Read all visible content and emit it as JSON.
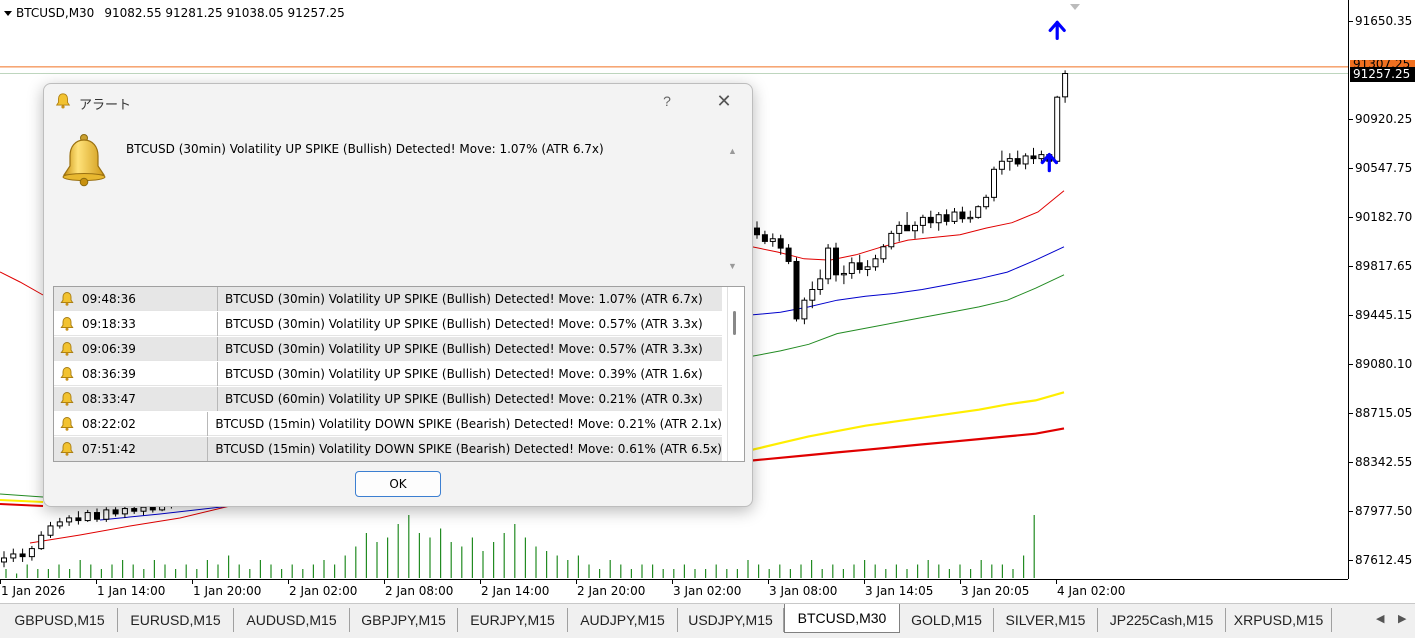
{
  "header": {
    "symbol": "BTCUSD,M30",
    "ohlc": "91082.55 91281.25 91038.05 91257.25"
  },
  "price_axis": {
    "labels": [
      "91650.35",
      "90920.25",
      "90547.75",
      "90182.70",
      "89817.65",
      "89445.15",
      "89080.10",
      "88715.05",
      "88342.55",
      "87977.50",
      "87612.45"
    ],
    "tag_orange": "91307.25",
    "tag_current": "91257.25"
  },
  "time_axis": {
    "labels": [
      "1 Jan 2026",
      "1 Jan 14:00",
      "1 Jan 20:00",
      "2 Jan 02:00",
      "2 Jan 08:00",
      "2 Jan 14:00",
      "2 Jan 20:00",
      "3 Jan 02:00",
      "3 Jan 08:00",
      "3 Jan 14:05",
      "3 Jan 20:05",
      "4 Jan 02:00"
    ]
  },
  "colors": {
    "bull": "#ffffff",
    "bear": "#000000",
    "ma_fast": "#e00000",
    "ma_mid": "#0000cc",
    "ma_slow": "#228b22",
    "ma_yellow": "#ffee00",
    "ma_red_thick": "#e00000",
    "volume": "#228b22",
    "arrow": "#0000ff",
    "price_line": "#f07020"
  },
  "chart_data": {
    "type": "candlestick",
    "symbol": "BTCUSD",
    "timeframe": "M30",
    "ylim": [
      87450,
      91800
    ],
    "last_price": 91257.25,
    "orange_level": 91307.25,
    "left_segment": [
      {
        "o": 87600,
        "h": 87680,
        "l": 87560,
        "c": 87630
      },
      {
        "o": 87630,
        "h": 87700,
        "l": 87600,
        "c": 87660
      },
      {
        "o": 87660,
        "h": 87700,
        "l": 87600,
        "c": 87640
      },
      {
        "o": 87640,
        "h": 87720,
        "l": 87610,
        "c": 87700
      },
      {
        "o": 87700,
        "h": 87830,
        "l": 87690,
        "c": 87800
      },
      {
        "o": 87800,
        "h": 87900,
        "l": 87780,
        "c": 87870
      },
      {
        "o": 87870,
        "h": 87930,
        "l": 87850,
        "c": 87900
      },
      {
        "o": 87900,
        "h": 87950,
        "l": 87870,
        "c": 87930
      },
      {
        "o": 87930,
        "h": 87980,
        "l": 87880,
        "c": 87910
      },
      {
        "o": 87910,
        "h": 87990,
        "l": 87900,
        "c": 87970
      },
      {
        "o": 87970,
        "h": 88000,
        "l": 87900,
        "c": 87920
      },
      {
        "o": 87920,
        "h": 88010,
        "l": 87900,
        "c": 87990
      },
      {
        "o": 87990,
        "h": 88010,
        "l": 87940,
        "c": 87960
      },
      {
        "o": 87960,
        "h": 88020,
        "l": 87930,
        "c": 88000
      },
      {
        "o": 88000,
        "h": 88040,
        "l": 87960,
        "c": 87980
      },
      {
        "o": 87980,
        "h": 88030,
        "l": 87950,
        "c": 88010
      },
      {
        "o": 88010,
        "h": 88050,
        "l": 87970,
        "c": 87990
      },
      {
        "o": 87990,
        "h": 88060,
        "l": 87980,
        "c": 88040
      },
      {
        "o": 88040,
        "h": 88080,
        "l": 88000,
        "c": 88020
      }
    ],
    "right_segment": [
      {
        "o": 90100,
        "h": 90150,
        "l": 90020,
        "c": 90050
      },
      {
        "o": 90050,
        "h": 90080,
        "l": 89980,
        "c": 90000
      },
      {
        "o": 90000,
        "h": 90060,
        "l": 89960,
        "c": 90020
      },
      {
        "o": 90020,
        "h": 90050,
        "l": 89900,
        "c": 89950
      },
      {
        "o": 89950,
        "h": 89980,
        "l": 89830,
        "c": 89850
      },
      {
        "o": 89850,
        "h": 89880,
        "l": 89400,
        "c": 89420
      },
      {
        "o": 89420,
        "h": 89580,
        "l": 89380,
        "c": 89560
      },
      {
        "o": 89560,
        "h": 89700,
        "l": 89500,
        "c": 89640
      },
      {
        "o": 89640,
        "h": 89790,
        "l": 89600,
        "c": 89720
      },
      {
        "o": 89720,
        "h": 89980,
        "l": 89680,
        "c": 89950
      },
      {
        "o": 89950,
        "h": 89990,
        "l": 89700,
        "c": 89750
      },
      {
        "o": 89750,
        "h": 89820,
        "l": 89680,
        "c": 89760
      },
      {
        "o": 89760,
        "h": 89880,
        "l": 89720,
        "c": 89840
      },
      {
        "o": 89840,
        "h": 89900,
        "l": 89760,
        "c": 89790
      },
      {
        "o": 89790,
        "h": 89860,
        "l": 89740,
        "c": 89810
      },
      {
        "o": 89810,
        "h": 89900,
        "l": 89780,
        "c": 89870
      },
      {
        "o": 89870,
        "h": 89980,
        "l": 89840,
        "c": 89960
      },
      {
        "o": 89960,
        "h": 90080,
        "l": 89940,
        "c": 90060
      },
      {
        "o": 90060,
        "h": 90150,
        "l": 90000,
        "c": 90120
      },
      {
        "o": 90120,
        "h": 90220,
        "l": 90080,
        "c": 90080
      },
      {
        "o": 90080,
        "h": 90150,
        "l": 90020,
        "c": 90120
      },
      {
        "o": 90120,
        "h": 90200,
        "l": 90060,
        "c": 90180
      },
      {
        "o": 90180,
        "h": 90230,
        "l": 90100,
        "c": 90140
      },
      {
        "o": 90140,
        "h": 90220,
        "l": 90080,
        "c": 90200
      },
      {
        "o": 90200,
        "h": 90240,
        "l": 90120,
        "c": 90150
      },
      {
        "o": 90150,
        "h": 90250,
        "l": 90130,
        "c": 90220
      },
      {
        "o": 90220,
        "h": 90260,
        "l": 90140,
        "c": 90170
      },
      {
        "o": 90170,
        "h": 90230,
        "l": 90140,
        "c": 90180
      },
      {
        "o": 90180,
        "h": 90270,
        "l": 90170,
        "c": 90260
      },
      {
        "o": 90260,
        "h": 90350,
        "l": 90240,
        "c": 90330
      },
      {
        "o": 90330,
        "h": 90560,
        "l": 90300,
        "c": 90540
      },
      {
        "o": 90540,
        "h": 90680,
        "l": 90500,
        "c": 90600
      },
      {
        "o": 90600,
        "h": 90660,
        "l": 90530,
        "c": 90620
      },
      {
        "o": 90620,
        "h": 90680,
        "l": 90560,
        "c": 90580
      },
      {
        "o": 90580,
        "h": 90660,
        "l": 90540,
        "c": 90640
      },
      {
        "o": 90640,
        "h": 90700,
        "l": 90580,
        "c": 90620
      },
      {
        "o": 90620,
        "h": 90680,
        "l": 90590,
        "c": 90650
      },
      {
        "o": 90650,
        "h": 90660,
        "l": 90560,
        "c": 90600
      },
      {
        "o": 90600,
        "h": 91090,
        "l": 90580,
        "c": 91080
      },
      {
        "o": 91082.55,
        "h": 91281.25,
        "l": 91038.05,
        "c": 91257.25
      }
    ],
    "arrows_up": [
      {
        "candle": 37,
        "price": 90650
      },
      {
        "candle": 38,
        "price": 91640
      }
    ],
    "moving_averages": [
      {
        "name": "fast",
        "color": "#e00000",
        "values": [
          89960,
          89920,
          89870,
          89860,
          89900,
          89960,
          90010,
          90030,
          90050,
          90100,
          90140,
          90220,
          90380
        ]
      },
      {
        "name": "mid",
        "color": "#0000cc",
        "values": [
          89450,
          89470,
          89510,
          89560,
          89590,
          89610,
          89640,
          89680,
          89720,
          89770,
          89860,
          89960
        ]
      },
      {
        "name": "slow",
        "color": "#228b22",
        "values": [
          89140,
          89180,
          89230,
          89310,
          89350,
          89390,
          89430,
          89470,
          89510,
          89560,
          89650,
          89750
        ]
      },
      {
        "name": "yellow",
        "color": "#ffee00",
        "values": [
          88440,
          88490,
          88540,
          88580,
          88620,
          88650,
          88680,
          88710,
          88740,
          88780,
          88810,
          88870
        ]
      },
      {
        "name": "red_thick",
        "color": "#e00000",
        "values": [
          88360,
          88380,
          88400,
          88420,
          88440,
          88460,
          88480,
          88500,
          88520,
          88540,
          88560,
          88600
        ]
      }
    ],
    "volume": [
      2,
      1,
      3,
      2,
      2,
      3,
      2,
      4,
      3,
      2,
      3,
      4,
      3,
      2,
      4,
      3,
      2,
      3,
      2,
      4,
      3,
      5,
      3,
      2,
      4,
      3,
      2,
      3,
      2,
      3,
      4,
      3,
      5,
      7,
      10,
      8,
      9,
      12,
      14,
      10,
      9,
      11,
      8,
      7,
      9,
      6,
      8,
      10,
      12,
      9,
      7,
      6,
      5,
      4,
      5,
      3,
      2,
      4,
      3,
      2,
      3,
      3,
      2,
      2,
      3,
      2,
      2,
      3,
      2,
      2,
      4,
      3,
      2,
      3,
      2,
      3,
      4,
      2,
      3,
      2,
      3,
      4,
      3,
      2,
      3,
      2,
      3,
      4,
      3,
      2,
      3,
      2,
      4,
      3,
      3,
      2,
      5,
      14
    ]
  },
  "dialog": {
    "title": "アラート",
    "help": "?",
    "close": "✕",
    "message": "BTCUSD (30min) Volatility UP SPIKE (Bullish) Detected! Move: 1.07% (ATR 6.7x)",
    "ok_label": "OK",
    "rows": [
      {
        "time": "09:48:36",
        "msg": "BTCUSD (30min) Volatility UP SPIKE (Bullish) Detected! Move: 1.07% (ATR 6.7x)"
      },
      {
        "time": "09:18:33",
        "msg": "BTCUSD (30min) Volatility UP SPIKE (Bullish) Detected! Move: 0.57% (ATR 3.3x)"
      },
      {
        "time": "09:06:39",
        "msg": "BTCUSD (30min) Volatility UP SPIKE (Bullish) Detected! Move: 0.57% (ATR 3.3x)"
      },
      {
        "time": "08:36:39",
        "msg": "BTCUSD (30min) Volatility UP SPIKE (Bullish) Detected! Move: 0.39% (ATR 1.6x)"
      },
      {
        "time": "08:33:47",
        "msg": "BTCUSD (60min) Volatility UP SPIKE (Bullish) Detected! Move: 0.21% (ATR 0.3x)"
      },
      {
        "time": "08:22:02",
        "msg": "BTCUSD (15min) Volatility DOWN SPIKE (Bearish) Detected! Move: 0.21% (ATR 2.1x)"
      },
      {
        "time": "07:51:42",
        "msg": "BTCUSD (15min) Volatility DOWN SPIKE (Bearish) Detected! Move: 0.61% (ATR 6.5x)"
      }
    ]
  },
  "tabs": [
    "GBPUSD,M15",
    "EURUSD,M15",
    "AUDUSD,M15",
    "GBPJPY,M15",
    "EURJPY,M15",
    "AUDJPY,M15",
    "USDJPY,M15",
    "BTCUSD,M30",
    "GOLD,M15",
    "SILVER,M15",
    "JP225Cash,M15",
    "XRPUSD,M15"
  ],
  "active_tab": "BTCUSD,M30",
  "tab_nav": {
    "prev": "◀",
    "next": "▶"
  }
}
